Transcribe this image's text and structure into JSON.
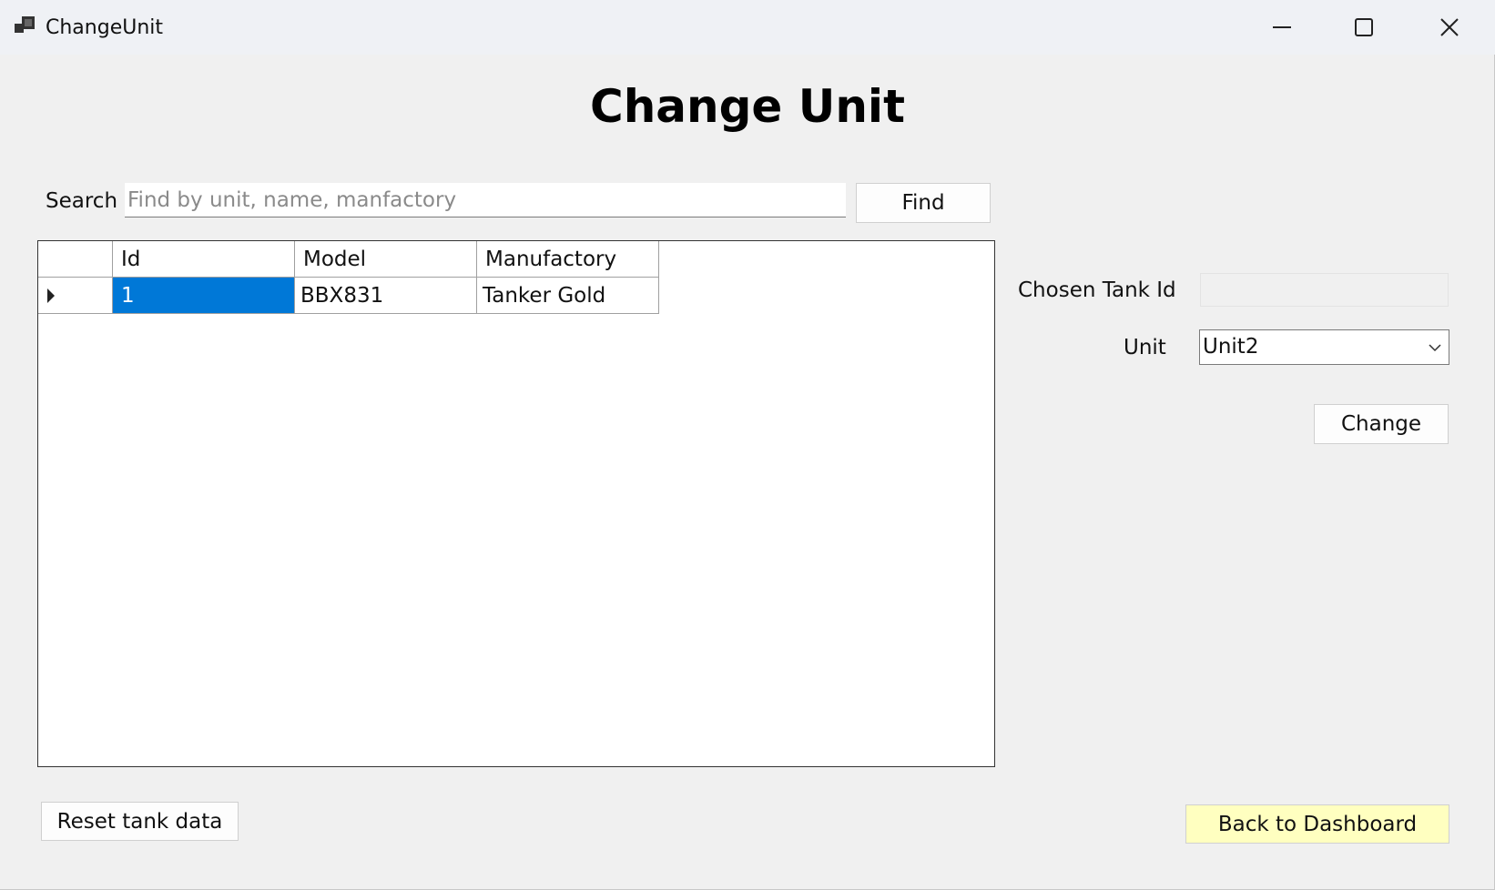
{
  "window": {
    "title": "ChangeUnit",
    "icon": "app-icon",
    "controls": {
      "minimize": "minimize-icon",
      "maximize": "maximize-icon",
      "close": "close-icon"
    }
  },
  "heading": "Change Unit",
  "search": {
    "label": "Search",
    "placeholder": "Find by unit, name, manfactory",
    "value": "",
    "find_label": "Find"
  },
  "grid": {
    "columns": [
      "Id",
      "Model",
      "Manufactory"
    ],
    "rows": [
      {
        "cells": [
          "1",
          "BBX831",
          "Tanker Gold"
        ],
        "current": true
      }
    ],
    "current_row_marker": "row-pointer-icon"
  },
  "details": {
    "chosen_tank_id_label": "Chosen Tank Id",
    "chosen_tank_id_value": "",
    "unit_label": "Unit",
    "unit_value": "Unit2",
    "change_label": "Change"
  },
  "footer": {
    "reset_label": "Reset tank data",
    "back_label": "Back to Dashboard"
  },
  "colors": {
    "selection": "#0078d7",
    "back_button": "#ffffc0",
    "window_bg": "#f0f0f0"
  }
}
